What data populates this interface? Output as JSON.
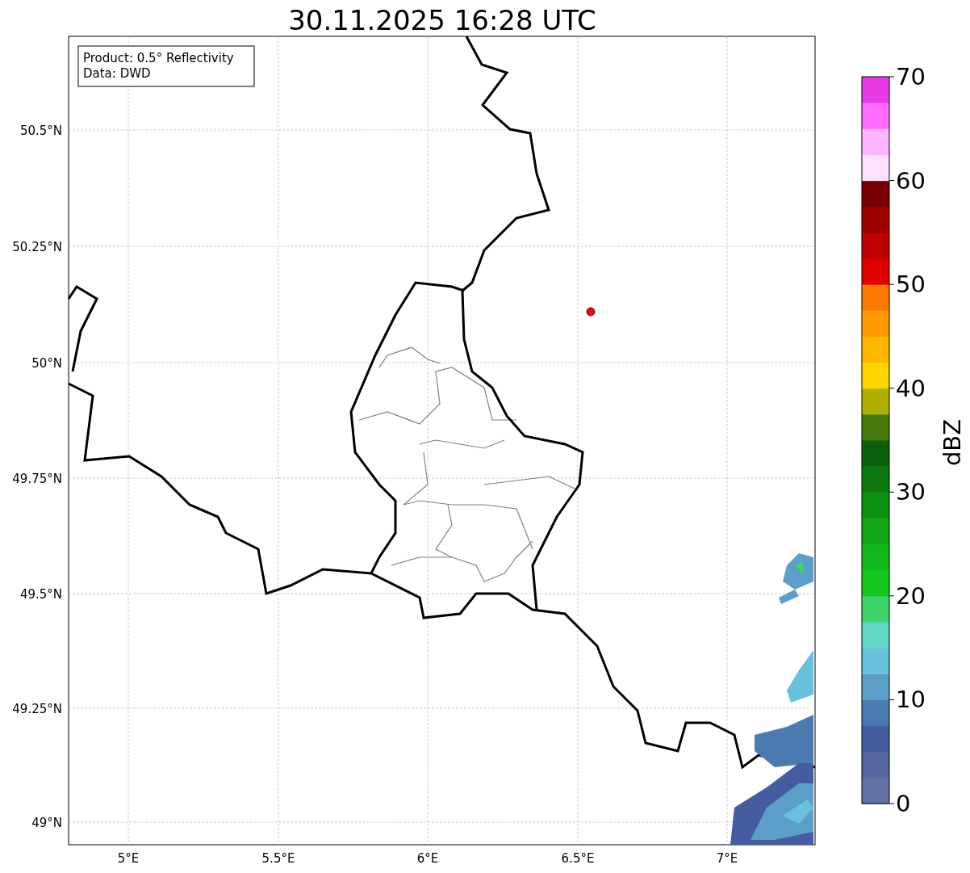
{
  "title": "30.11.2025 16:28 UTC",
  "info_box": {
    "lines": [
      "Product: 0.5° Reflectivity",
      "Data: DWD"
    ]
  },
  "map": {
    "x_ticks": [
      "5°E",
      "5.5°E",
      "6°E",
      "6.5°E",
      "7°E"
    ],
    "y_ticks": [
      "50.5°N",
      "50.25°N",
      "50°N",
      "49.75°N",
      "49.5°N",
      "49.25°N",
      "49°N"
    ]
  },
  "colorbar": {
    "label": "dBZ",
    "ticks": [
      "70",
      "60",
      "50",
      "40",
      "30",
      "20",
      "10",
      "0"
    ],
    "bins": [
      {
        "color": "#6272a6"
      },
      {
        "color": "#5366a0"
      },
      {
        "color": "#445ca0"
      },
      {
        "color": "#4b7ab2"
      },
      {
        "color": "#5b9ec8"
      },
      {
        "color": "#67c1de"
      },
      {
        "color": "#60d7c4"
      },
      {
        "color": "#3dd56e"
      },
      {
        "color": "#12c81c"
      },
      {
        "color": "#10b81a"
      },
      {
        "color": "#10a616"
      },
      {
        "color": "#0c9010"
      },
      {
        "color": "#0c7a10"
      },
      {
        "color": "#0a600c"
      },
      {
        "color": "#467a0a"
      },
      {
        "color": "#b0b000"
      },
      {
        "color": "#ffd700"
      },
      {
        "color": "#ffb800"
      },
      {
        "color": "#ff9a00"
      },
      {
        "color": "#ff7800"
      },
      {
        "color": "#e00000"
      },
      {
        "color": "#c00000"
      },
      {
        "color": "#a00000"
      },
      {
        "color": "#780000"
      },
      {
        "color": "#ffe0ff"
      },
      {
        "color": "#ffb4ff"
      },
      {
        "color": "#ff6cff"
      },
      {
        "color": "#e838e8"
      }
    ]
  }
}
